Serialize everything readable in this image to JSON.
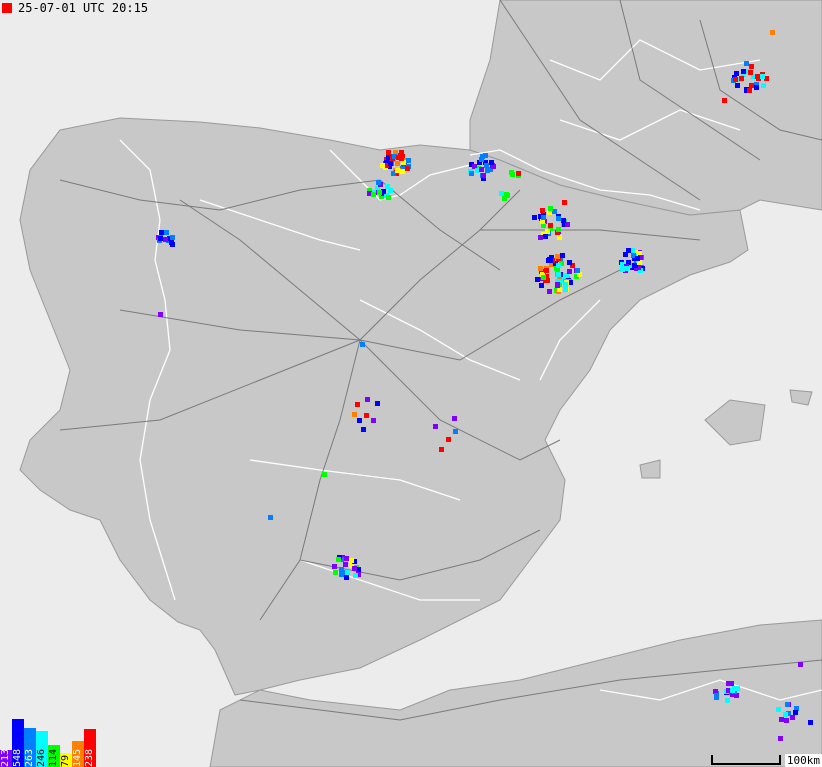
{
  "timestamp": "25-07-01 UTC 20:15",
  "timestamp_color": "#ff0000",
  "legend": [
    {
      "label": "213",
      "color": "#8000ff",
      "level": 0.35
    },
    {
      "label": "548",
      "color": "#0000ff",
      "level": 1.0
    },
    {
      "label": "263",
      "color": "#0080ff",
      "level": 0.82
    },
    {
      "label": "246",
      "color": "#00ffff",
      "level": 0.75
    },
    {
      "label": "114",
      "color": "#00ff00",
      "level": 0.45
    },
    {
      "label": "79",
      "color": "#ffff00",
      "level": 0.3
    },
    {
      "label": "145",
      "color": "#ff8000",
      "level": 0.55
    },
    {
      "label": "238",
      "color": "#ff0000",
      "level": 0.8
    }
  ],
  "scale_label": "100km",
  "colors": {
    "sea": "#ececec",
    "land": "#c8c8c8",
    "roads": "#7a7a7a",
    "borders": "#ffffff"
  }
}
